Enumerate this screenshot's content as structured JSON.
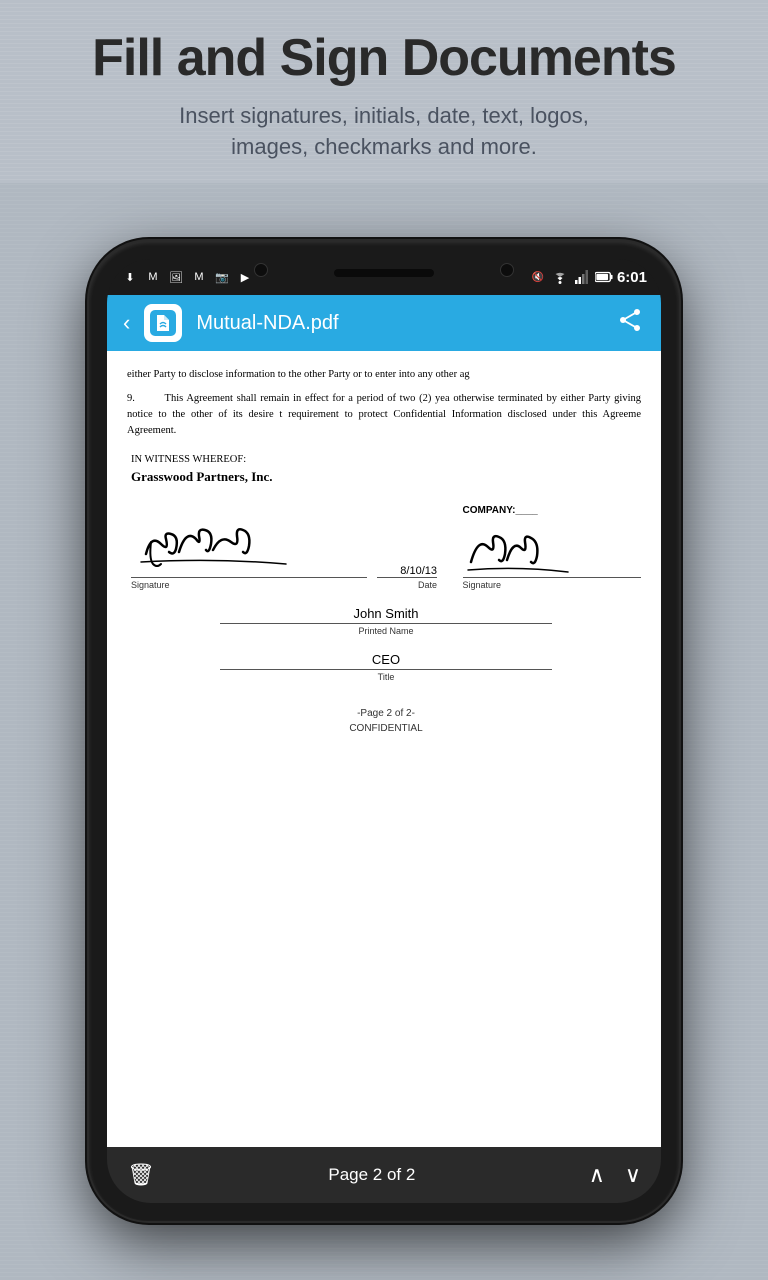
{
  "promo": {
    "title": "Fill and Sign Documents",
    "subtitle": "Insert signatures, initials, date, text, logos,\nimages, checkmarks and more."
  },
  "status_bar": {
    "time": "6:01",
    "icons_left": [
      "download",
      "gmail",
      "image",
      "gmail",
      "camera",
      "store"
    ],
    "signal_muted": true
  },
  "toolbar": {
    "title": "Mutual-NDA.pdf",
    "back_label": "‹",
    "share_label": "share"
  },
  "document": {
    "paragraph_8_text": "either Party to disclose information to the other Party or to enter into any other ag",
    "paragraph_9_text": "9.        This Agreement shall remain in effect for a period of two (2) yea otherwise terminated by either Party giving notice to the other of its desire t requirement to protect Confidential Information disclosed under this Agreeme Agreement.",
    "witness_label": "IN WITNESS WHEREOF:",
    "company_name": "Grasswood Partners, Inc.",
    "company_label": "COMPANY:____",
    "signature_label": "Signature",
    "date_label": "Date",
    "date_value": "8/10/13",
    "right_signature_label": "Signature",
    "printed_name_value": "John Smith",
    "printed_name_label": "Printed Name",
    "title_value": "CEO",
    "title_label": "Title",
    "page_footer_line1": "-Page 2 of 2-",
    "page_footer_line2": "CONFIDENTIAL"
  },
  "bottom_toolbar": {
    "page_info": "Page 2 of 2",
    "trash_label": "🗑",
    "up_label": "∧",
    "down_label": "∨"
  }
}
